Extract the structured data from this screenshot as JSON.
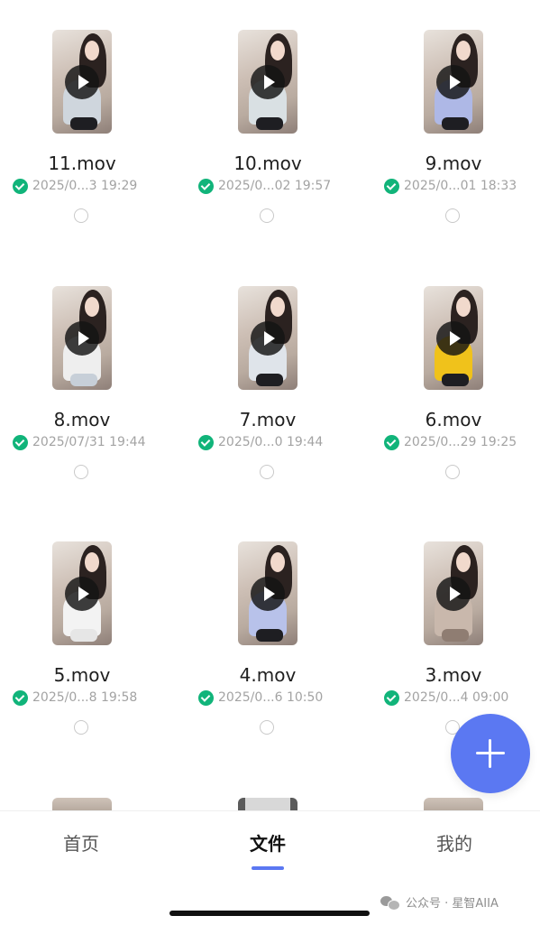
{
  "files": [
    {
      "name": "11.mov",
      "time": "2025/0...3 19:29"
    },
    {
      "name": "10.mov",
      "time": "2025/0...02 19:57"
    },
    {
      "name": "9.mov",
      "time": "2025/0...01 18:33"
    },
    {
      "name": "8.mov",
      "time": "2025/07/31 19:44"
    },
    {
      "name": "7.mov",
      "time": "2025/0...0 19:44"
    },
    {
      "name": "6.mov",
      "time": "2025/0...29 19:25"
    },
    {
      "name": "5.mov",
      "time": "2025/0...8 19:58"
    },
    {
      "name": "4.mov",
      "time": "2025/0...6 10:50"
    },
    {
      "name": "3.mov",
      "time": "2025/0...4 09:00"
    }
  ],
  "tabs": [
    {
      "label": "首页",
      "active": false
    },
    {
      "label": "文件",
      "active": true
    },
    {
      "label": "我的",
      "active": false
    }
  ],
  "fab": {
    "icon": "plus-icon"
  },
  "watermark": {
    "text": "公众号 · 星智AIIA",
    "icon": "wechat-icon"
  },
  "icons": {
    "sync_status": "check-circle-icon",
    "play": "play-icon",
    "select": "radio-circle-icon"
  },
  "colors": {
    "accent": "#5b78f2",
    "success": "#11b47a"
  }
}
